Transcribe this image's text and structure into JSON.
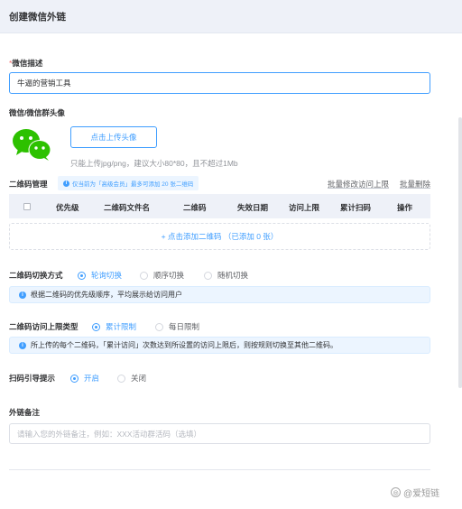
{
  "header": {
    "title": "创建微信外链"
  },
  "wechat_desc": {
    "required_mark": "*",
    "label": "微信描述",
    "value": "牛逼的营销工具"
  },
  "avatar": {
    "label": "微信/微信群头像",
    "icon": "wechat-logo-icon",
    "upload_label": "点击上传头像",
    "hint": "只能上传jpg/png，建议大小80*80，且不超过1Mb"
  },
  "qr_manage": {
    "label": "二维码管理",
    "tip": "仅当前为「高级会员」最多可添加 20 张二维码",
    "batch_edit_label": "批量修改访问上限",
    "batch_delete_label": "批量删除",
    "columns": [
      "优先级",
      "二维码文件名",
      "二维码",
      "失效日期",
      "访问上限",
      "累计扫码",
      "操作"
    ],
    "add_label": "+ 点击添加二维码 （已添加 0 张）"
  },
  "switch_mode": {
    "label": "二维码切换方式",
    "options": [
      "轮询切换",
      "顺序切换",
      "随机切换"
    ],
    "selected": 0,
    "notice": "根据二维码的优先级顺序，平均展示给访问用户"
  },
  "limit_type": {
    "label": "二维码访问上限类型",
    "options": [
      "累计限制",
      "每日限制"
    ],
    "selected": 0,
    "notice": "所上传的每个二维码，「累计访问」次数达到所设置的访问上限后，则按规则切换至其他二维码。"
  },
  "scan_tip": {
    "label": "扫码引导提示",
    "options": [
      "开启",
      "关闭"
    ],
    "selected": 0
  },
  "remark": {
    "label": "外链备注",
    "placeholder": "请输入您的外链备注，例如：XXX活动群活码（选填）"
  },
  "watermark": {
    "text": "@爱短链"
  },
  "colors": {
    "primary": "#409eff",
    "header_bg": "#eef1f8",
    "wechat_green": "#2dc100"
  }
}
